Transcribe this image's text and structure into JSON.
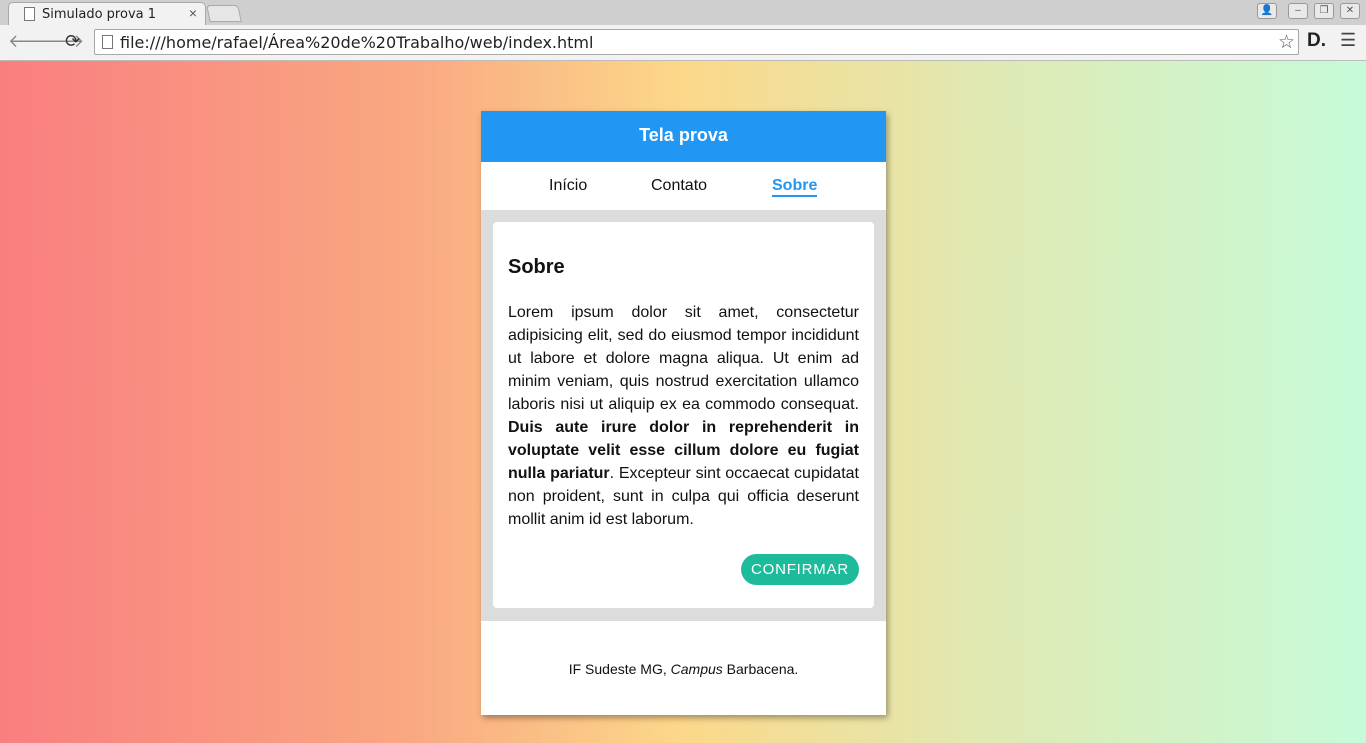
{
  "browser": {
    "tab_title": "Simulado prova 1",
    "tab_close": "×",
    "url": "file:///home/rafael/Área%20de%20Trabalho/web/index.html",
    "window_controls": [
      "👤",
      "–",
      "❐",
      "✕"
    ],
    "back_icon": "🡐",
    "forward_icon": "🡒",
    "reload_icon": "⟳",
    "star_icon": "☆",
    "extension_label": "D.",
    "menu_icon": "☰"
  },
  "app": {
    "header_title": "Tela prova",
    "nav": [
      {
        "label": "Início",
        "active": false
      },
      {
        "label": "Contato",
        "active": false
      },
      {
        "label": "Sobre",
        "active": true
      }
    ],
    "section_title": "Sobre",
    "text_plain_1": "Lorem ipsum dolor sit amet, consectetur adipisicing elit, sed do eiusmod tempor incididunt ut labore et dolore magna aliqua. Ut enim ad minim veniam, quis nostrud exercitation ullamco laboris nisi ut aliquip ex ea commodo consequat. ",
    "text_bold": "Duis aute irure dolor in reprehenderit in voluptate velit esse cillum dolore eu fugiat nulla pariatur",
    "text_plain_2": ". Excepteur sint occaecat cupidatat non proident, sunt in culpa qui officia deserunt mollit anim id est laborum.",
    "confirm_label": "CONFIRMAR",
    "footer_prefix": "IF Sudeste MG, ",
    "footer_campus": "Campus",
    "footer_suffix": " Barbacena."
  },
  "colors": {
    "primary": "#2196f3",
    "confirm": "#1dbb9c"
  }
}
